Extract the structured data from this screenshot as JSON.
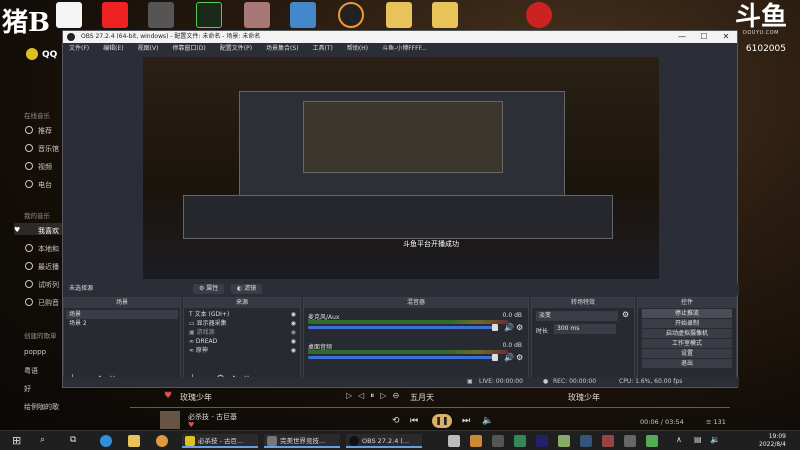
{
  "overlay": {
    "brand": "猪B",
    "qq_label": "QQ",
    "douyu_glyph": "斗鱼",
    "douyu_url": "DOUYU.COM",
    "room_id": "6102005"
  },
  "music_sidebar": {
    "section_online": "在线音乐",
    "items_online": [
      "推荐",
      "音乐馆",
      "视频",
      "电台"
    ],
    "section_mine": "我的音乐",
    "items_mine": [
      "我喜欢",
      "本地和",
      "最近播",
      "试听列",
      "已购音"
    ],
    "section_created": "创建的歌单",
    "playlists": [
      "poppp",
      "粤语",
      "好",
      "给例咖的歌"
    ]
  },
  "obs": {
    "window_title": "OBS 27.2.4 (64-bit, windows) - 配置文件: 未命名 - 场景: 未命名",
    "window_buttons": [
      "—",
      "☐",
      "✕"
    ],
    "menu": [
      "文件(F)",
      "编辑(E)",
      "视图(V)",
      "停靠窗口(D)",
      "配置文件(P)",
      "场景集合(S)",
      "工具(T)",
      "帮助(H)",
      "斗鱼-小博FFFF..."
    ],
    "preview_toast": "斗鱼平台开播成功",
    "scene_bar_label": "未选择源",
    "scene_bar_props": "属性",
    "scene_bar_filters": "滤镜",
    "docks": {
      "scenes": {
        "title": "场景",
        "items": [
          "场景",
          "场景 2"
        ]
      },
      "sources": {
        "title": "来源",
        "items": [
          "文本 (GDI+)",
          "显示器采集",
          "游戏源",
          "DREAD",
          "原神"
        ]
      },
      "mixer": {
        "title": "混音器",
        "tracks": [
          {
            "name": "麦克风/Aux",
            "db": "0.0 dB"
          },
          {
            "name": "桌面音频",
            "db": "0.0 dB"
          }
        ]
      },
      "transitions": {
        "title": "转场特效",
        "effect": "淡变",
        "duration_label": "时长",
        "duration_value": "300 ms"
      },
      "controls": {
        "title": "控件",
        "buttons": [
          "停止推流",
          "开始录制",
          "启动虚拟摄像机",
          "工作室模式",
          "设置",
          "退出"
        ]
      }
    },
    "status": {
      "live": "LIVE: 00:00:00",
      "rec": "REC: 00:00:00",
      "cpu": "CPU: 1.6%, 60.00 fps"
    }
  },
  "player": {
    "lyric_left": "玫瑰少年",
    "lyric_center": "五月天",
    "lyric_right": "玫瑰少年",
    "song_title": "必杀技 - 古巨基",
    "time": "00:06 / 03:54",
    "count": "131"
  },
  "taskbar": {
    "apps": [
      "必杀技 - 古巨...",
      "完美世界竞技...",
      "OBS 27.2.4 (..."
    ],
    "time": "19:09",
    "date": "2022/8/4"
  }
}
